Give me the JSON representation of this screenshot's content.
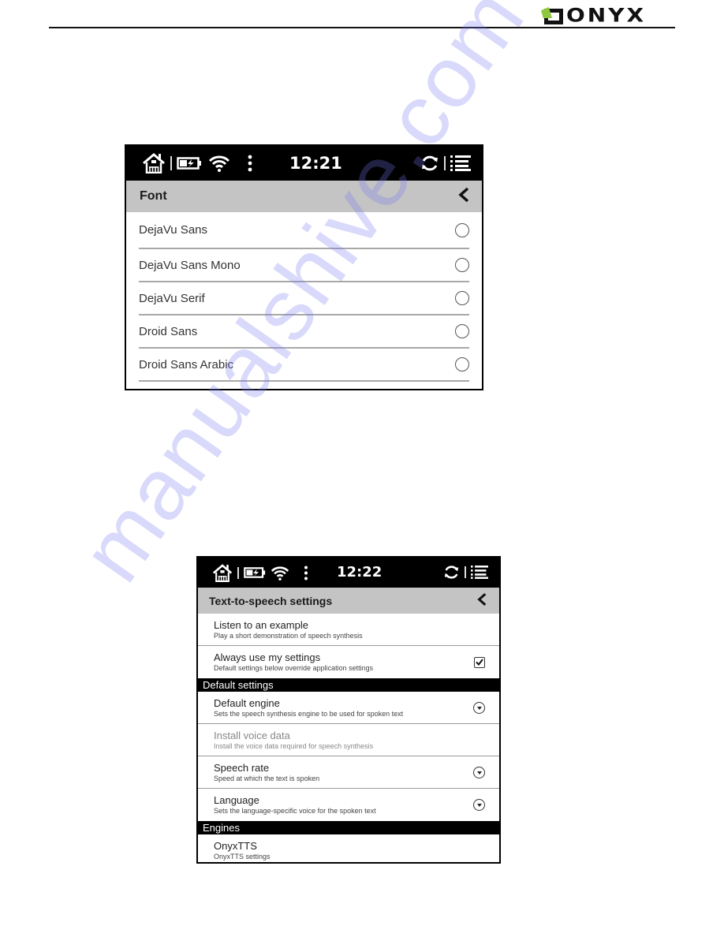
{
  "header": {
    "logo_text": "ONYX",
    "logo_accent_color": "#8dc63f"
  },
  "font_screen": {
    "status_bar": {
      "time": "12:21",
      "icons": [
        "home-icon",
        "battery-charging-icon",
        "wifi-icon",
        "more-vert-icon",
        "refresh-icon",
        "menu-list-icon"
      ]
    },
    "title": "Font",
    "back_icon": "chevron-left-icon",
    "items": [
      {
        "label": "DejaVu Sans",
        "selected": false
      },
      {
        "label": "DejaVu Sans Mono",
        "selected": false
      },
      {
        "label": "DejaVu Serif",
        "selected": false
      },
      {
        "label": "Droid Sans",
        "selected": false
      },
      {
        "label": "Droid Sans Arabic",
        "selected": false
      }
    ]
  },
  "tts_screen": {
    "status_bar": {
      "time": "12:22",
      "icons": [
        "home-icon",
        "battery-charging-icon",
        "wifi-icon",
        "more-vert-icon",
        "refresh-icon",
        "menu-list-icon"
      ]
    },
    "title": "Text-to-speech settings",
    "back_icon": "chevron-left-icon",
    "items": [
      {
        "title": "Listen to an example",
        "summary": "Play a short demonstration of speech synthesis"
      },
      {
        "title": "Always use my settings",
        "summary": "Default settings below override application settings",
        "checked": true
      }
    ],
    "sections": [
      {
        "header": "Default settings",
        "items": [
          {
            "title": "Default engine",
            "summary": "Sets the speech synthesis engine to be used for spoken text",
            "control": "dropdown"
          },
          {
            "title": "Install voice data",
            "summary": "Install the voice data required for speech synthesis",
            "disabled": true
          },
          {
            "title": "Speech rate",
            "summary": "Speed at which the text is spoken",
            "control": "dropdown"
          },
          {
            "title": "Language",
            "summary": "Sets the language-specific voice for the spoken text",
            "control": "dropdown"
          }
        ]
      },
      {
        "header": "Engines",
        "items": [
          {
            "title": "OnyxTTS",
            "summary": "OnyxTTS settings"
          }
        ]
      }
    ]
  },
  "watermark": "manualshive.com"
}
